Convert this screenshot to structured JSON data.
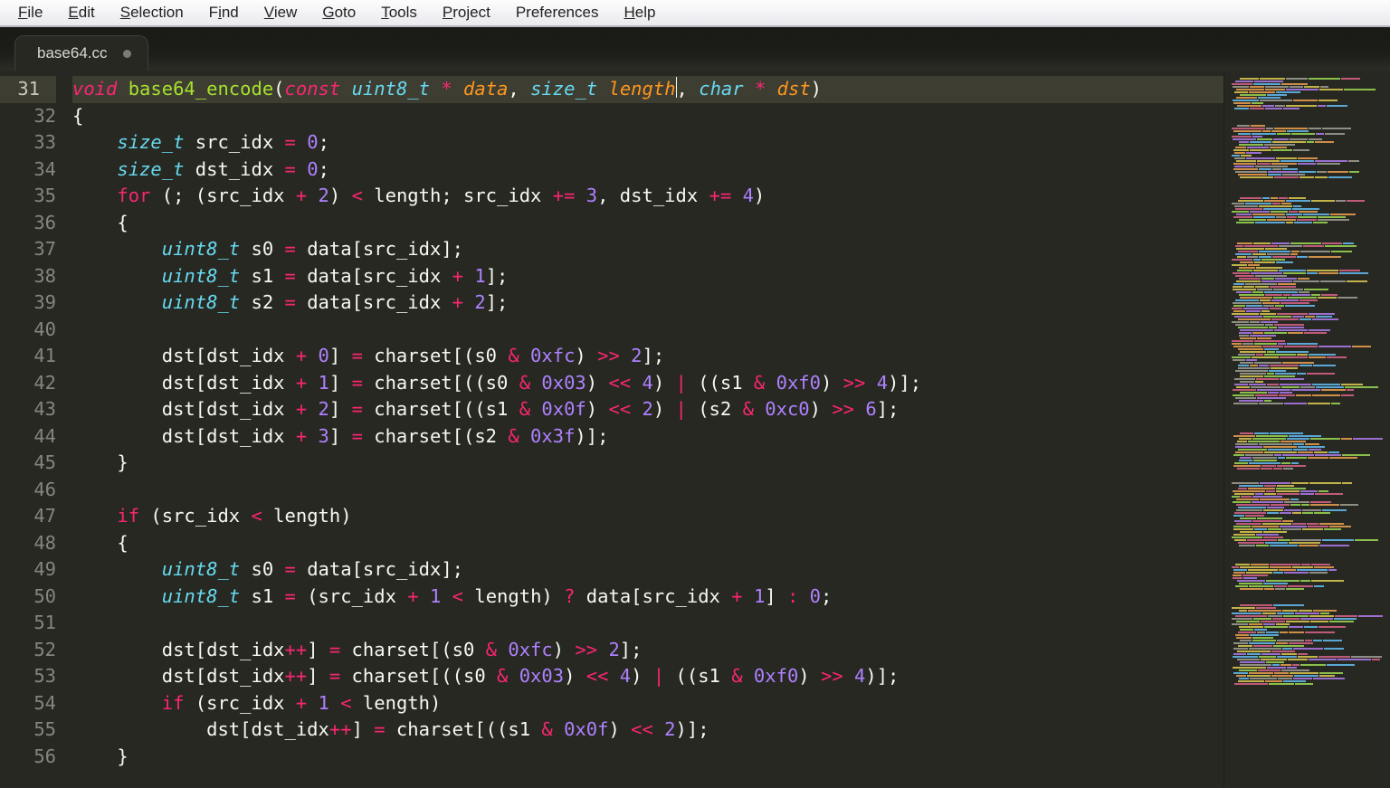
{
  "menubar": {
    "items": [
      {
        "label": "File",
        "accel": "F"
      },
      {
        "label": "Edit",
        "accel": "E"
      },
      {
        "label": "Selection",
        "accel": "S"
      },
      {
        "label": "Find",
        "accel": "i"
      },
      {
        "label": "View",
        "accel": "V"
      },
      {
        "label": "Goto",
        "accel": "G"
      },
      {
        "label": "Tools",
        "accel": "T"
      },
      {
        "label": "Project",
        "accel": "P"
      },
      {
        "label": "Preferences",
        "accel": ""
      },
      {
        "label": "Help",
        "accel": "H"
      }
    ]
  },
  "tabs": {
    "active": {
      "filename": "base64.cc",
      "dirty": true
    }
  },
  "editor": {
    "first_line_number": 31,
    "active_line_number": 31,
    "lines": [
      {
        "n": 31,
        "tokens": [
          {
            "t": "void",
            "c": "kw"
          },
          {
            "t": " "
          },
          {
            "t": "base64_encode",
            "c": "fn"
          },
          {
            "t": "(",
            "c": "pun"
          },
          {
            "t": "const",
            "c": "kw"
          },
          {
            "t": " "
          },
          {
            "t": "uint8_t",
            "c": "type"
          },
          {
            "t": " "
          },
          {
            "t": "*",
            "c": "op"
          },
          {
            "t": " "
          },
          {
            "t": "data",
            "c": "param"
          },
          {
            "t": ", ",
            "c": "pun"
          },
          {
            "t": "size_t",
            "c": "type"
          },
          {
            "t": " "
          },
          {
            "t": "length",
            "c": "param"
          },
          {
            "t": "|",
            "c": "cursor"
          },
          {
            "t": ", ",
            "c": "pun"
          },
          {
            "t": "char",
            "c": "type"
          },
          {
            "t": " "
          },
          {
            "t": "*",
            "c": "op"
          },
          {
            "t": " "
          },
          {
            "t": "dst",
            "c": "param"
          },
          {
            "t": ")",
            "c": "pun"
          }
        ]
      },
      {
        "n": 32,
        "tokens": [
          {
            "t": "{",
            "c": "pun"
          }
        ]
      },
      {
        "n": 33,
        "tokens": [
          {
            "t": "    "
          },
          {
            "t": "size_t",
            "c": "type"
          },
          {
            "t": " src_idx ",
            "c": "id"
          },
          {
            "t": "=",
            "c": "op"
          },
          {
            "t": " "
          },
          {
            "t": "0",
            "c": "num"
          },
          {
            "t": ";",
            "c": "pun"
          }
        ]
      },
      {
        "n": 34,
        "tokens": [
          {
            "t": "    "
          },
          {
            "t": "size_t",
            "c": "type"
          },
          {
            "t": " dst_idx ",
            "c": "id"
          },
          {
            "t": "=",
            "c": "op"
          },
          {
            "t": " "
          },
          {
            "t": "0",
            "c": "num"
          },
          {
            "t": ";",
            "c": "pun"
          }
        ]
      },
      {
        "n": 35,
        "tokens": [
          {
            "t": "    "
          },
          {
            "t": "for",
            "c": "kw-n"
          },
          {
            "t": " (; (src_idx ",
            "c": "id"
          },
          {
            "t": "+",
            "c": "op"
          },
          {
            "t": " "
          },
          {
            "t": "2",
            "c": "num"
          },
          {
            "t": ") ",
            "c": "pun"
          },
          {
            "t": "<",
            "c": "op"
          },
          {
            "t": " length; src_idx ",
            "c": "id"
          },
          {
            "t": "+=",
            "c": "op"
          },
          {
            "t": " "
          },
          {
            "t": "3",
            "c": "num"
          },
          {
            "t": ", dst_idx ",
            "c": "id"
          },
          {
            "t": "+=",
            "c": "op"
          },
          {
            "t": " "
          },
          {
            "t": "4",
            "c": "num"
          },
          {
            "t": ")",
            "c": "pun"
          }
        ]
      },
      {
        "n": 36,
        "tokens": [
          {
            "t": "    {",
            "c": "pun"
          }
        ]
      },
      {
        "n": 37,
        "tokens": [
          {
            "t": "        "
          },
          {
            "t": "uint8_t",
            "c": "type"
          },
          {
            "t": " s0 ",
            "c": "id"
          },
          {
            "t": "=",
            "c": "op"
          },
          {
            "t": " data[src_idx];",
            "c": "id"
          }
        ]
      },
      {
        "n": 38,
        "tokens": [
          {
            "t": "        "
          },
          {
            "t": "uint8_t",
            "c": "type"
          },
          {
            "t": " s1 ",
            "c": "id"
          },
          {
            "t": "=",
            "c": "op"
          },
          {
            "t": " data[src_idx ",
            "c": "id"
          },
          {
            "t": "+",
            "c": "op"
          },
          {
            "t": " "
          },
          {
            "t": "1",
            "c": "num"
          },
          {
            "t": "];",
            "c": "pun"
          }
        ]
      },
      {
        "n": 39,
        "tokens": [
          {
            "t": "        "
          },
          {
            "t": "uint8_t",
            "c": "type"
          },
          {
            "t": " s2 ",
            "c": "id"
          },
          {
            "t": "=",
            "c": "op"
          },
          {
            "t": " data[src_idx ",
            "c": "id"
          },
          {
            "t": "+",
            "c": "op"
          },
          {
            "t": " "
          },
          {
            "t": "2",
            "c": "num"
          },
          {
            "t": "];",
            "c": "pun"
          }
        ]
      },
      {
        "n": 40,
        "tokens": [
          {
            "t": ""
          }
        ]
      },
      {
        "n": 41,
        "tokens": [
          {
            "t": "        dst[dst_idx ",
            "c": "id"
          },
          {
            "t": "+",
            "c": "op"
          },
          {
            "t": " "
          },
          {
            "t": "0",
            "c": "num"
          },
          {
            "t": "] ",
            "c": "pun"
          },
          {
            "t": "=",
            "c": "op"
          },
          {
            "t": " charset[(s0 ",
            "c": "id"
          },
          {
            "t": "&",
            "c": "op"
          },
          {
            "t": " "
          },
          {
            "t": "0xfc",
            "c": "num"
          },
          {
            "t": ") ",
            "c": "pun"
          },
          {
            "t": ">>",
            "c": "op"
          },
          {
            "t": " "
          },
          {
            "t": "2",
            "c": "num"
          },
          {
            "t": "];",
            "c": "pun"
          }
        ]
      },
      {
        "n": 42,
        "tokens": [
          {
            "t": "        dst[dst_idx ",
            "c": "id"
          },
          {
            "t": "+",
            "c": "op"
          },
          {
            "t": " "
          },
          {
            "t": "1",
            "c": "num"
          },
          {
            "t": "] ",
            "c": "pun"
          },
          {
            "t": "=",
            "c": "op"
          },
          {
            "t": " charset[((s0 ",
            "c": "id"
          },
          {
            "t": "&",
            "c": "op"
          },
          {
            "t": " "
          },
          {
            "t": "0x03",
            "c": "num"
          },
          {
            "t": ") ",
            "c": "pun"
          },
          {
            "t": "<<",
            "c": "op"
          },
          {
            "t": " "
          },
          {
            "t": "4",
            "c": "num"
          },
          {
            "t": ") ",
            "c": "pun"
          },
          {
            "t": "|",
            "c": "op"
          },
          {
            "t": " ((s1 ",
            "c": "id"
          },
          {
            "t": "&",
            "c": "op"
          },
          {
            "t": " "
          },
          {
            "t": "0xf0",
            "c": "num"
          },
          {
            "t": ") ",
            "c": "pun"
          },
          {
            "t": ">>",
            "c": "op"
          },
          {
            "t": " "
          },
          {
            "t": "4",
            "c": "num"
          },
          {
            "t": ")];",
            "c": "pun"
          }
        ]
      },
      {
        "n": 43,
        "tokens": [
          {
            "t": "        dst[dst_idx ",
            "c": "id"
          },
          {
            "t": "+",
            "c": "op"
          },
          {
            "t": " "
          },
          {
            "t": "2",
            "c": "num"
          },
          {
            "t": "] ",
            "c": "pun"
          },
          {
            "t": "=",
            "c": "op"
          },
          {
            "t": " charset[((s1 ",
            "c": "id"
          },
          {
            "t": "&",
            "c": "op"
          },
          {
            "t": " "
          },
          {
            "t": "0x0f",
            "c": "num"
          },
          {
            "t": ") ",
            "c": "pun"
          },
          {
            "t": "<<",
            "c": "op"
          },
          {
            "t": " "
          },
          {
            "t": "2",
            "c": "num"
          },
          {
            "t": ") ",
            "c": "pun"
          },
          {
            "t": "|",
            "c": "op"
          },
          {
            "t": " (s2 ",
            "c": "id"
          },
          {
            "t": "&",
            "c": "op"
          },
          {
            "t": " "
          },
          {
            "t": "0xc0",
            "c": "num"
          },
          {
            "t": ") ",
            "c": "pun"
          },
          {
            "t": ">>",
            "c": "op"
          },
          {
            "t": " "
          },
          {
            "t": "6",
            "c": "num"
          },
          {
            "t": "];",
            "c": "pun"
          }
        ]
      },
      {
        "n": 44,
        "tokens": [
          {
            "t": "        dst[dst_idx ",
            "c": "id"
          },
          {
            "t": "+",
            "c": "op"
          },
          {
            "t": " "
          },
          {
            "t": "3",
            "c": "num"
          },
          {
            "t": "] ",
            "c": "pun"
          },
          {
            "t": "=",
            "c": "op"
          },
          {
            "t": " charset[(s2 ",
            "c": "id"
          },
          {
            "t": "&",
            "c": "op"
          },
          {
            "t": " "
          },
          {
            "t": "0x3f",
            "c": "num"
          },
          {
            "t": ")];",
            "c": "pun"
          }
        ]
      },
      {
        "n": 45,
        "tokens": [
          {
            "t": "    }",
            "c": "pun"
          }
        ]
      },
      {
        "n": 46,
        "tokens": [
          {
            "t": ""
          }
        ]
      },
      {
        "n": 47,
        "tokens": [
          {
            "t": "    "
          },
          {
            "t": "if",
            "c": "kw-n"
          },
          {
            "t": " (src_idx ",
            "c": "id"
          },
          {
            "t": "<",
            "c": "op"
          },
          {
            "t": " length)",
            "c": "id"
          }
        ]
      },
      {
        "n": 48,
        "tokens": [
          {
            "t": "    {",
            "c": "pun"
          }
        ]
      },
      {
        "n": 49,
        "tokens": [
          {
            "t": "        "
          },
          {
            "t": "uint8_t",
            "c": "type"
          },
          {
            "t": " s0 ",
            "c": "id"
          },
          {
            "t": "=",
            "c": "op"
          },
          {
            "t": " data[src_idx];",
            "c": "id"
          }
        ]
      },
      {
        "n": 50,
        "tokens": [
          {
            "t": "        "
          },
          {
            "t": "uint8_t",
            "c": "type"
          },
          {
            "t": " s1 ",
            "c": "id"
          },
          {
            "t": "=",
            "c": "op"
          },
          {
            "t": " (src_idx ",
            "c": "id"
          },
          {
            "t": "+",
            "c": "op"
          },
          {
            "t": " "
          },
          {
            "t": "1",
            "c": "num"
          },
          {
            "t": " ",
            "c": "pun"
          },
          {
            "t": "<",
            "c": "op"
          },
          {
            "t": " length) ",
            "c": "id"
          },
          {
            "t": "?",
            "c": "op"
          },
          {
            "t": " data[src_idx ",
            "c": "id"
          },
          {
            "t": "+",
            "c": "op"
          },
          {
            "t": " "
          },
          {
            "t": "1",
            "c": "num"
          },
          {
            "t": "] ",
            "c": "pun"
          },
          {
            "t": ":",
            "c": "op"
          },
          {
            "t": " "
          },
          {
            "t": "0",
            "c": "num"
          },
          {
            "t": ";",
            "c": "pun"
          }
        ]
      },
      {
        "n": 51,
        "tokens": [
          {
            "t": ""
          }
        ]
      },
      {
        "n": 52,
        "tokens": [
          {
            "t": "        dst[dst_idx",
            "c": "id"
          },
          {
            "t": "++",
            "c": "op"
          },
          {
            "t": "] ",
            "c": "pun"
          },
          {
            "t": "=",
            "c": "op"
          },
          {
            "t": " charset[(s0 ",
            "c": "id"
          },
          {
            "t": "&",
            "c": "op"
          },
          {
            "t": " "
          },
          {
            "t": "0xfc",
            "c": "num"
          },
          {
            "t": ") ",
            "c": "pun"
          },
          {
            "t": ">>",
            "c": "op"
          },
          {
            "t": " "
          },
          {
            "t": "2",
            "c": "num"
          },
          {
            "t": "];",
            "c": "pun"
          }
        ]
      },
      {
        "n": 53,
        "tokens": [
          {
            "t": "        dst[dst_idx",
            "c": "id"
          },
          {
            "t": "++",
            "c": "op"
          },
          {
            "t": "] ",
            "c": "pun"
          },
          {
            "t": "=",
            "c": "op"
          },
          {
            "t": " charset[((s0 ",
            "c": "id"
          },
          {
            "t": "&",
            "c": "op"
          },
          {
            "t": " "
          },
          {
            "t": "0x03",
            "c": "num"
          },
          {
            "t": ") ",
            "c": "pun"
          },
          {
            "t": "<<",
            "c": "op"
          },
          {
            "t": " "
          },
          {
            "t": "4",
            "c": "num"
          },
          {
            "t": ") ",
            "c": "pun"
          },
          {
            "t": "|",
            "c": "op"
          },
          {
            "t": " ((s1 ",
            "c": "id"
          },
          {
            "t": "&",
            "c": "op"
          },
          {
            "t": " "
          },
          {
            "t": "0xf0",
            "c": "num"
          },
          {
            "t": ") ",
            "c": "pun"
          },
          {
            "t": ">>",
            "c": "op"
          },
          {
            "t": " "
          },
          {
            "t": "4",
            "c": "num"
          },
          {
            "t": ")];",
            "c": "pun"
          }
        ]
      },
      {
        "n": 54,
        "tokens": [
          {
            "t": "        "
          },
          {
            "t": "if",
            "c": "kw-n"
          },
          {
            "t": " (src_idx ",
            "c": "id"
          },
          {
            "t": "+",
            "c": "op"
          },
          {
            "t": " "
          },
          {
            "t": "1",
            "c": "num"
          },
          {
            "t": " ",
            "c": "pun"
          },
          {
            "t": "<",
            "c": "op"
          },
          {
            "t": " length)",
            "c": "id"
          }
        ]
      },
      {
        "n": 55,
        "tokens": [
          {
            "t": "            dst[dst_idx",
            "c": "id"
          },
          {
            "t": "++",
            "c": "op"
          },
          {
            "t": "] ",
            "c": "pun"
          },
          {
            "t": "=",
            "c": "op"
          },
          {
            "t": " charset[((s1 ",
            "c": "id"
          },
          {
            "t": "&",
            "c": "op"
          },
          {
            "t": " "
          },
          {
            "t": "0x0f",
            "c": "num"
          },
          {
            "t": ") ",
            "c": "pun"
          },
          {
            "t": "<<",
            "c": "op"
          },
          {
            "t": " "
          },
          {
            "t": "2",
            "c": "num"
          },
          {
            "t": ")];",
            "c": "pun"
          }
        ]
      },
      {
        "n": 56,
        "tokens": [
          {
            "t": "    }",
            "c": "pun"
          }
        ]
      }
    ]
  }
}
